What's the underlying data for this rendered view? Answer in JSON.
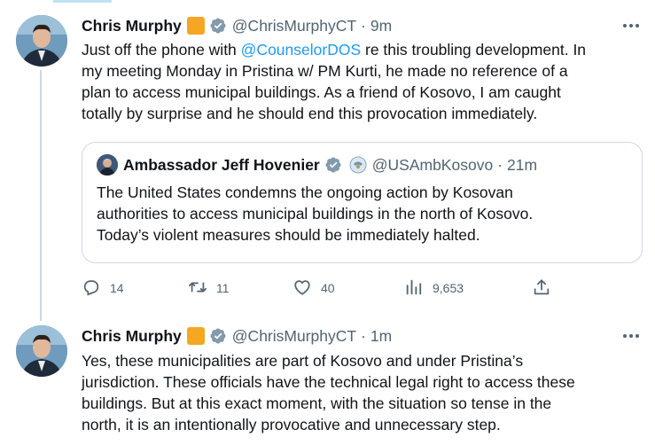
{
  "tweets": [
    {
      "name": "Chris Murphy",
      "handle": "@ChrisMurphyCT",
      "separator": "·",
      "time": "9m",
      "text_lines": [
        [
          "Just off the phone with ",
          "@CounselorDOS",
          " re this troubling development. In"
        ],
        "my meeting Monday in Pristina w/ PM Kurti, he made no reference of a",
        "plan to access municipal buildings. As a friend of Kosovo, I am caught",
        "totally by surprise and he should end this provocation immediately."
      ],
      "quote": {
        "name": "Ambassador Jeff Hovenier",
        "handle": "@USAmbKosovo",
        "separator": "·",
        "time": "21m",
        "text_lines": [
          "The United States condemns the ongoing action by Kosovan",
          "authorities to access municipal buildings in the north of Kosovo.",
          "Today’s violent measures should be immediately halted."
        ]
      },
      "actions": {
        "replies": "14",
        "retweets": "11",
        "likes": "40",
        "views": "9,653"
      }
    },
    {
      "name": "Chris Murphy",
      "handle": "@ChrisMurphyCT",
      "separator": "·",
      "time": "1m",
      "text_lines": [
        "Yes, these municipalities are part of Kosovo and under Pristina’s",
        "jurisdiction. These officials have the technical legal right to access these",
        "buildings. But at this exact moment, with the situation so tense in the",
        "north, it is an intentionally provocative and unnecessary step."
      ]
    }
  ],
  "icons": {
    "more": "more-horizontal-icon",
    "verified": "verified-badge-icon",
    "org_badge": "organization-badge-icon",
    "government": "government-affiliation-icon",
    "reply": "reply-icon",
    "retweet": "retweet-icon",
    "like": "heart-icon",
    "views": "views-chart-icon",
    "share": "share-icon"
  },
  "colors": {
    "link": "#1d9bf0",
    "muted": "#536471",
    "text": "#0f1419",
    "org_badge": "#f5a623",
    "verified_badge": "#829aab",
    "border": "#cfd9de"
  }
}
